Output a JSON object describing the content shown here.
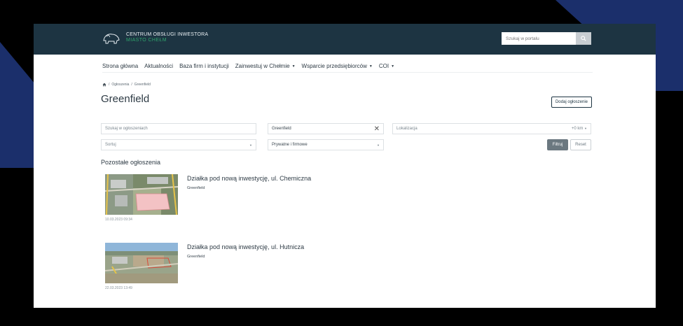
{
  "header": {
    "logo_line1": "CENTRUM OBSŁUGI INWESTORA",
    "logo_line2": "MIASTO CHEŁM",
    "search_placeholder": "Szukaj w portalu"
  },
  "nav": {
    "items": [
      {
        "label": "Strona główna"
      },
      {
        "label": "Aktualności"
      },
      {
        "label": "Baza firm i instytucji"
      },
      {
        "label": "Zainwestuj w Chełmie"
      },
      {
        "label": "Wsparcie przedsiębiorców"
      },
      {
        "label": "COI"
      }
    ]
  },
  "breadcrumb": {
    "level1": "Ogłoszenia",
    "separator": "/",
    "level2": "Greenfield"
  },
  "page": {
    "title": "Greenfield",
    "add_button": "Dodaj ogłoszenie"
  },
  "filters": {
    "search_placeholder": "Szukaj w ogłoszeniach",
    "category_value": "Greenfield",
    "location_placeholder": "Lokalizacja",
    "radius": "+0 km",
    "sort_placeholder": "Sortuj",
    "type_value": "Prywatne i firmowe",
    "filter_button": "Filtruj",
    "reset_button": "Reset"
  },
  "section": {
    "title": "Pozostałe ogłoszenia"
  },
  "listings": [
    {
      "title": "Działka pod nową inwestycję, ul. Chemiczna",
      "category": "Greenfield",
      "timestamp": "10.03.2023 09:34"
    },
    {
      "title": "Działka pod nową inwestycję, ul. Hutnicza",
      "category": "Greenfield",
      "timestamp": "22.03.2023 13:49"
    }
  ],
  "colors": {
    "topbar": "#1d3442",
    "accent_green": "#2fa36b",
    "filter_button": "#6b7880"
  }
}
